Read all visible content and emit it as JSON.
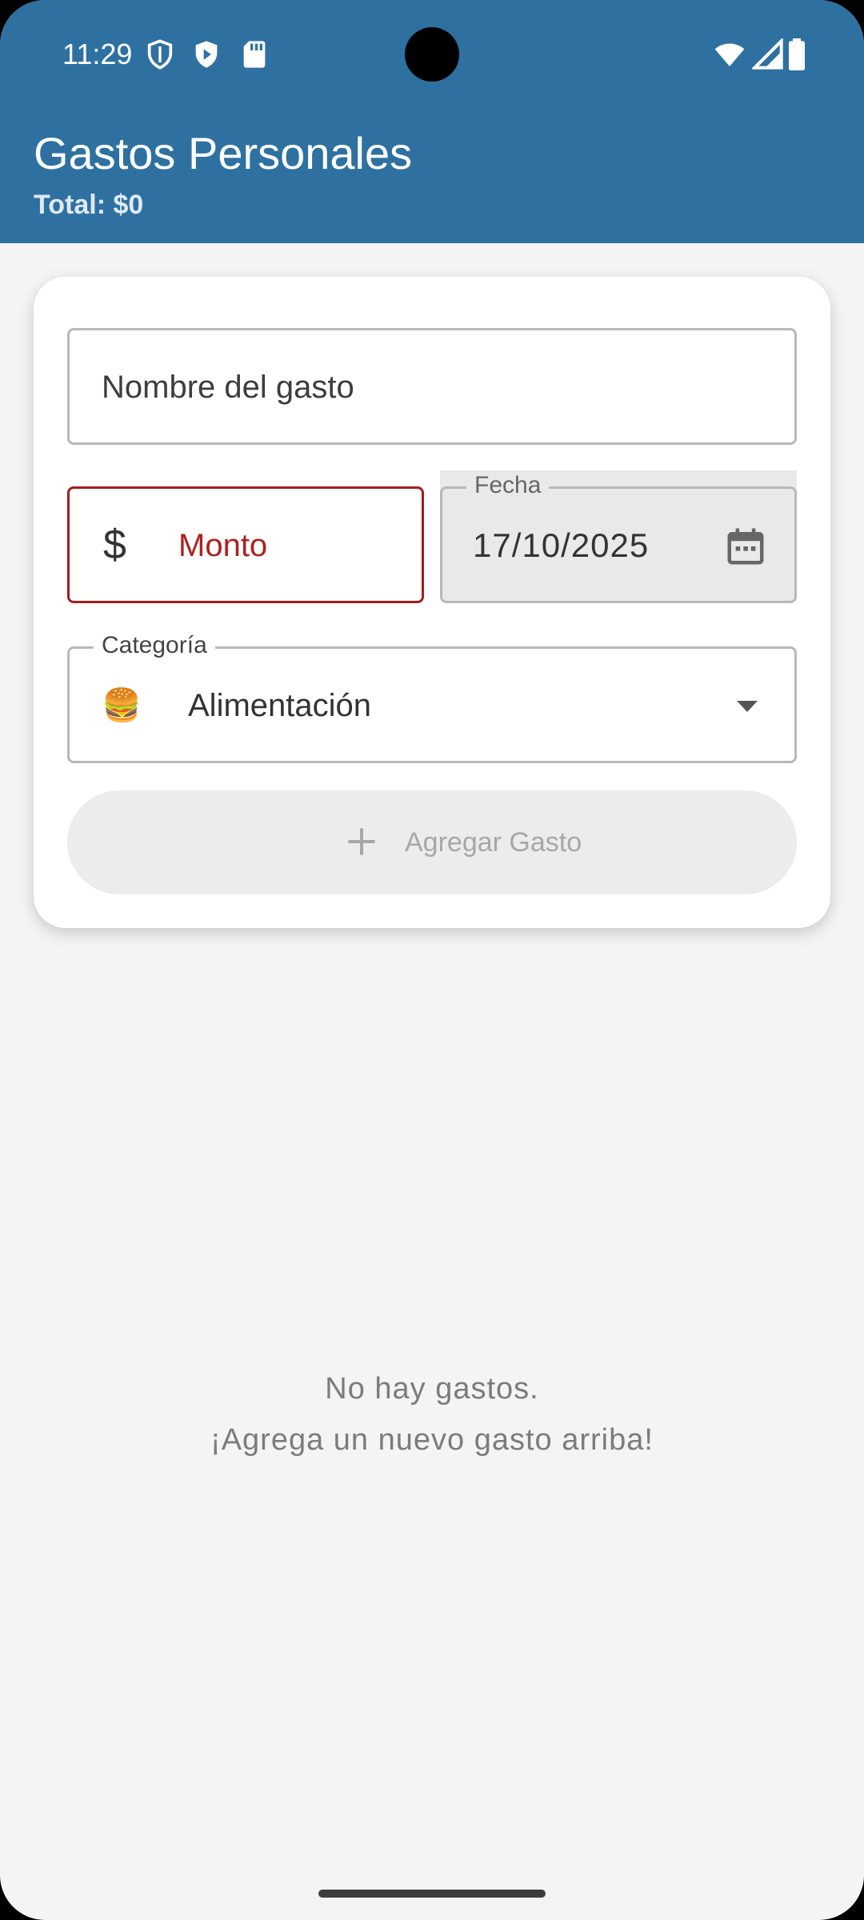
{
  "status_bar": {
    "time": "11:29",
    "left_icons": [
      "shield-icon",
      "play-protect-icon",
      "sd-card-icon"
    ],
    "right_icons": [
      "wifi-icon",
      "signal-icon",
      "battery-icon"
    ]
  },
  "header": {
    "title": "Gastos Personales",
    "subtitle": "Total: $0",
    "color": "#2e71a1"
  },
  "form": {
    "name_placeholder": "Nombre del gasto",
    "amount_prefix": "$",
    "amount_placeholder": "Monto",
    "amount_error_color": "#a51d1d",
    "date_label": "Fecha",
    "date_value": "17/10/2025",
    "date_icon": "calendar-icon",
    "category_label": "Categoría",
    "category_emoji": "🍔",
    "category_value": "Alimentación",
    "category_icon": "dropdown-arrow-icon",
    "add_button_label": "Agregar Gasto",
    "add_button_icon": "plus-icon"
  },
  "empty_state": {
    "line1": "No hay gastos.",
    "line2": "¡Agrega un nuevo gasto arriba!"
  }
}
